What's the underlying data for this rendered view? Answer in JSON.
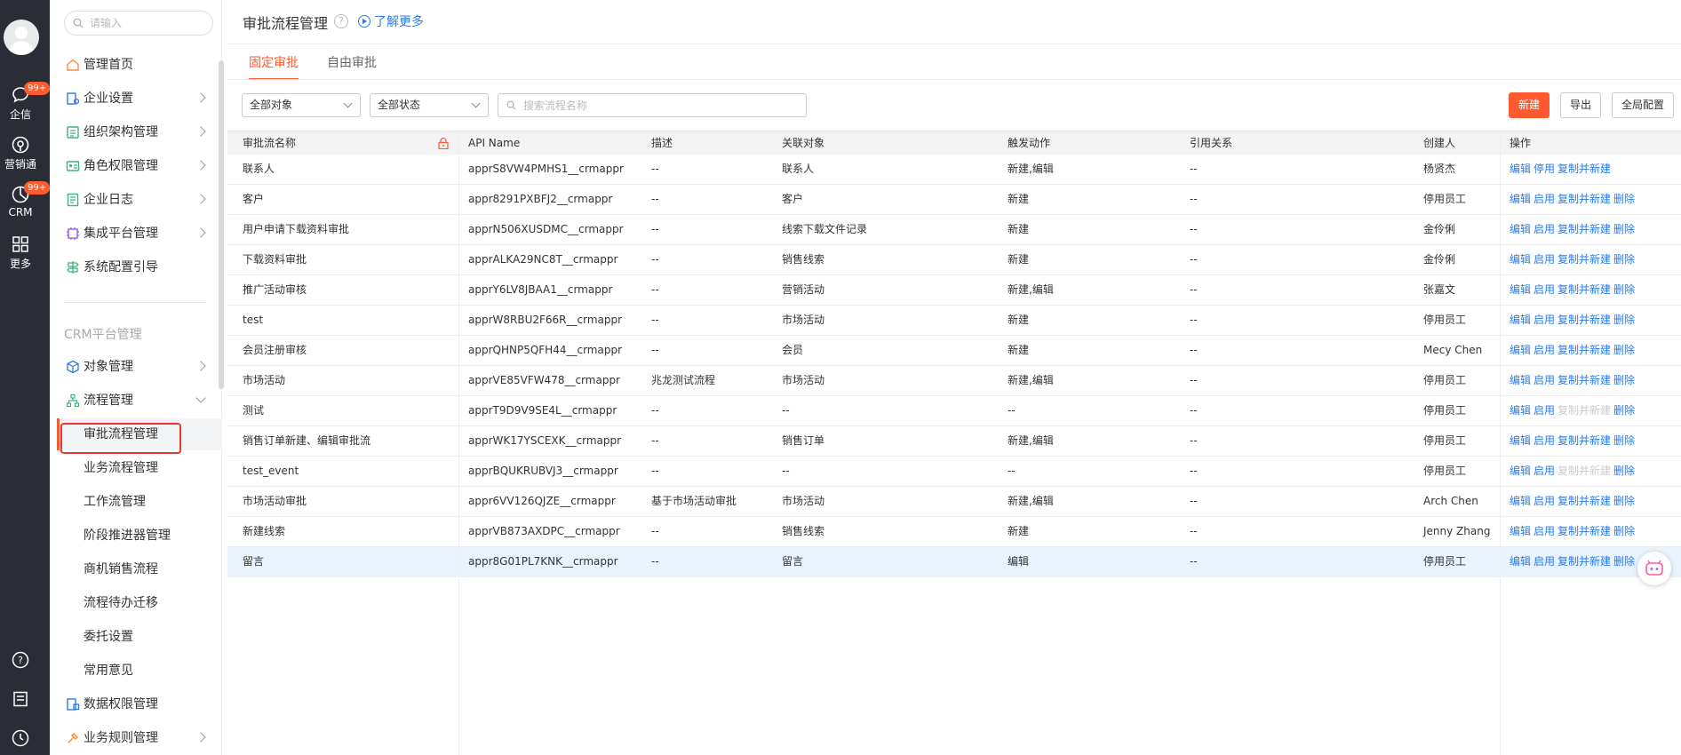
{
  "rail": {
    "items": [
      {
        "label": "企信",
        "badge": "99+",
        "icon": "chat-icon"
      },
      {
        "label": "营销通",
        "icon": "marketing-icon"
      },
      {
        "label": "CRM",
        "badge": "99+",
        "icon": "crm-icon"
      },
      {
        "label": "更多",
        "icon": "apps-grid-icon"
      }
    ],
    "bottom_icons": [
      "help-icon",
      "notes-icon",
      "clock-icon"
    ]
  },
  "nav": {
    "search_placeholder": "请输入",
    "items": [
      {
        "label": "管理首页",
        "icon": "home-icon"
      },
      {
        "label": "企业设置",
        "icon": "enterprise-settings-icon"
      },
      {
        "label": "组织架构管理",
        "icon": "org-structure-icon"
      },
      {
        "label": "角色权限管理",
        "icon": "role-permission-icon"
      },
      {
        "label": "企业日志",
        "icon": "log-icon"
      },
      {
        "label": "集成平台管理",
        "icon": "integration-icon"
      },
      {
        "label": "系统配置引导",
        "icon": "config-guide-icon"
      }
    ],
    "section_title": "CRM平台管理",
    "crm_items": [
      {
        "label": "对象管理",
        "icon": "object-icon"
      },
      {
        "label": "流程管理",
        "icon": "flow-icon"
      }
    ],
    "sub_items": [
      "审批流程管理",
      "业务流程管理",
      "工作流管理",
      "阶段推进器管理",
      "商机销售流程",
      "流程待办迁移",
      "委托设置",
      "常用意见"
    ],
    "after_items": [
      {
        "label": "数据权限管理",
        "icon": "data-permission-icon"
      },
      {
        "label": "业务规则管理",
        "icon": "business-rule-icon"
      }
    ]
  },
  "header": {
    "title": "审批流程管理",
    "learn_more": "了解更多"
  },
  "tabs": [
    "固定审批",
    "自由审批"
  ],
  "filters": {
    "object": "全部对象",
    "status": "全部状态",
    "search_placeholder": "搜索流程名称"
  },
  "actions": {
    "new": "新建",
    "export": "导出",
    "global_config": "全局配置"
  },
  "table": {
    "columns": [
      "审批流名称",
      "API Name",
      "描述",
      "关联对象",
      "触发动作",
      "引用关系",
      "创建人",
      "操作"
    ],
    "rows": [
      {
        "name": "联系人",
        "api": "apprS8VW4PMHS1__crmappr",
        "desc": "--",
        "obj": "联系人",
        "trigger": "新建,编辑",
        "ref": "--",
        "creator": "杨贤杰",
        "ops": [
          "编辑",
          "停用",
          "复制并新建"
        ],
        "dis": []
      },
      {
        "name": "客户",
        "api": "appr8291PXBFJ2__crmappr",
        "desc": "--",
        "obj": "客户",
        "trigger": "新建",
        "ref": "--",
        "creator": "停用员工",
        "ops": [
          "编辑",
          "启用",
          "复制并新建",
          "删除"
        ],
        "dis": []
      },
      {
        "name": "用户申请下载资料审批",
        "api": "apprN506XUSDMC__crmappr",
        "desc": "--",
        "obj": "线索下载文件记录",
        "trigger": "新建",
        "ref": "--",
        "creator": "金伶俐",
        "ops": [
          "编辑",
          "启用",
          "复制并新建",
          "删除"
        ],
        "dis": []
      },
      {
        "name": "下载资料审批",
        "api": "apprALKA29NC8T__crmappr",
        "desc": "--",
        "obj": "销售线索",
        "trigger": "新建",
        "ref": "--",
        "creator": "金伶俐",
        "ops": [
          "编辑",
          "启用",
          "复制并新建",
          "删除"
        ],
        "dis": []
      },
      {
        "name": "推广活动审核",
        "api": "apprY6LV8JBAA1__crmappr",
        "desc": "--",
        "obj": "营销活动",
        "trigger": "新建,编辑",
        "ref": "--",
        "creator": "张嘉文",
        "ops": [
          "编辑",
          "启用",
          "复制并新建",
          "删除"
        ],
        "dis": []
      },
      {
        "name": "test",
        "api": "apprW8RBU2F66R__crmappr",
        "desc": "--",
        "obj": "市场活动",
        "trigger": "新建",
        "ref": "--",
        "creator": "停用员工",
        "ops": [
          "编辑",
          "启用",
          "复制并新建",
          "删除"
        ],
        "dis": []
      },
      {
        "name": "会员注册审核",
        "api": "apprQHNP5QFH44__crmappr",
        "desc": "--",
        "obj": "会员",
        "trigger": "新建",
        "ref": "--",
        "creator": "Mecy Chen",
        "ops": [
          "编辑",
          "启用",
          "复制并新建",
          "删除"
        ],
        "dis": []
      },
      {
        "name": "市场活动",
        "api": "apprVE85VFW478__crmappr",
        "desc": "兆龙测试流程",
        "obj": "市场活动",
        "trigger": "新建,编辑",
        "ref": "--",
        "creator": "停用员工",
        "ops": [
          "编辑",
          "启用",
          "复制并新建",
          "删除"
        ],
        "dis": []
      },
      {
        "name": "测试",
        "api": "apprT9D9V9SE4L__crmappr",
        "desc": "--",
        "obj": "--",
        "trigger": "--",
        "ref": "--",
        "creator": "停用员工",
        "ops": [
          "编辑",
          "启用",
          "复制并新建",
          "删除"
        ],
        "dis": [
          2
        ]
      },
      {
        "name": "销售订单新建、编辑审批流",
        "api": "apprWK17YSCEXK__crmappr",
        "desc": "--",
        "obj": "销售订单",
        "trigger": "新建,编辑",
        "ref": "--",
        "creator": "停用员工",
        "ops": [
          "编辑",
          "启用",
          "复制并新建",
          "删除"
        ],
        "dis": []
      },
      {
        "name": "test_event",
        "api": "apprBQUKRUBVJ3__crmappr",
        "desc": "--",
        "obj": "--",
        "trigger": "--",
        "ref": "--",
        "creator": "停用员工",
        "ops": [
          "编辑",
          "启用",
          "复制并新建",
          "删除"
        ],
        "dis": [
          2
        ]
      },
      {
        "name": "市场活动审批",
        "api": "appr6VV126QJZE__crmappr",
        "desc": "基于市场活动审批",
        "obj": "市场活动",
        "trigger": "新建,编辑",
        "ref": "--",
        "creator": "Arch Chen",
        "ops": [
          "编辑",
          "启用",
          "复制并新建",
          "删除"
        ],
        "dis": []
      },
      {
        "name": "新建线索",
        "api": "apprVB873AXDPC__crmappr",
        "desc": "--",
        "obj": "销售线索",
        "trigger": "新建",
        "ref": "--",
        "creator": "Jenny Zhang",
        "ops": [
          "编辑",
          "启用",
          "复制并新建",
          "删除"
        ],
        "dis": []
      },
      {
        "name": "留言",
        "api": "appr8G01PL7KNK__crmappr",
        "desc": "--",
        "obj": "留言",
        "trigger": "编辑",
        "ref": "--",
        "creator": "停用员工",
        "ops": [
          "编辑",
          "启用",
          "复制并新建",
          "删除"
        ],
        "dis": []
      }
    ]
  },
  "colors": {
    "accent": "#ff5a2e",
    "link": "#2c7be5",
    "rail": "#2a2d35",
    "selected_row": "#e8f3fd"
  }
}
